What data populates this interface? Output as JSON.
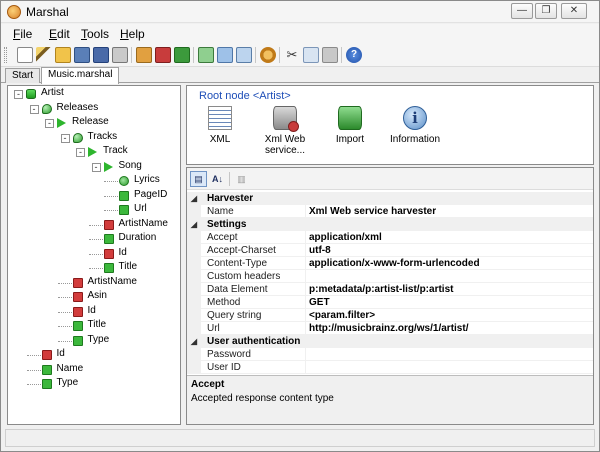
{
  "window": {
    "title": "Marshal",
    "minimize_glyph": "—",
    "restore_glyph": "❐",
    "close_glyph": "✕"
  },
  "menu": [
    {
      "label": "File",
      "key": "F",
      "rest": "ile"
    },
    {
      "label": "Edit",
      "key": "E",
      "rest": "dit"
    },
    {
      "label": "Tools",
      "key": "T",
      "rest": "ools"
    },
    {
      "label": "Help",
      "key": "H",
      "rest": "elp"
    }
  ],
  "toolbar": {
    "icons": [
      "new-icon",
      "wand-icon",
      "open-icon",
      "save-icon",
      "save-all-icon",
      "print-icon",
      "export-icon",
      "import-icon",
      "harvest-icon",
      "validate-icon",
      "template-icon",
      "schema-icon",
      "options-icon",
      "cut-icon",
      "copy-icon",
      "paste-icon",
      "help-icon"
    ]
  },
  "tabs": [
    {
      "label": "Start",
      "active": false
    },
    {
      "label": "Music.marshal",
      "active": true
    }
  ],
  "tree": [
    {
      "label": "Artist",
      "icon": "db",
      "depth": 0,
      "expander": "-"
    },
    {
      "label": "Releases",
      "icon": "key",
      "depth": 1,
      "expander": "-"
    },
    {
      "label": "Release",
      "icon": "play",
      "depth": 2,
      "expander": "-"
    },
    {
      "label": "Tracks",
      "icon": "key",
      "depth": 3,
      "expander": "-"
    },
    {
      "label": "Track",
      "icon": "play",
      "depth": 4,
      "expander": "-"
    },
    {
      "label": "Song",
      "icon": "play",
      "depth": 5,
      "expander": "-"
    },
    {
      "label": "Lyrics",
      "icon": "circle",
      "depth": 6
    },
    {
      "label": "PageID",
      "icon": "green",
      "depth": 6
    },
    {
      "label": "Url",
      "icon": "green",
      "depth": 6
    },
    {
      "label": "ArtistName",
      "icon": "red",
      "depth": 5
    },
    {
      "label": "Duration",
      "icon": "green",
      "depth": 5
    },
    {
      "label": "Id",
      "icon": "red",
      "depth": 5
    },
    {
      "label": "Title",
      "icon": "green",
      "depth": 5
    },
    {
      "label": "ArtistName",
      "icon": "red",
      "depth": 3
    },
    {
      "label": "Asin",
      "icon": "red",
      "depth": 3
    },
    {
      "label": "Id",
      "icon": "red",
      "depth": 3
    },
    {
      "label": "Title",
      "icon": "green",
      "depth": 3
    },
    {
      "label": "Type",
      "icon": "green",
      "depth": 3
    },
    {
      "label": "Id",
      "icon": "red",
      "depth": 1
    },
    {
      "label": "Name",
      "icon": "green",
      "depth": 1
    },
    {
      "label": "Type",
      "icon": "green",
      "depth": 1
    }
  ],
  "root_node": {
    "title": "Root node <Artist>",
    "actions": [
      {
        "label": "XML",
        "icon": "xml-icon"
      },
      {
        "label": "Xml Web service...",
        "icon": "web-service-icon"
      },
      {
        "label": "Import",
        "icon": "import-icon"
      },
      {
        "label": "Information",
        "icon": "information-icon"
      }
    ]
  },
  "property_grid": {
    "sort_buttons": [
      "categorized-icon",
      "alphabetical-icon",
      "property-pages-icon"
    ],
    "rows": [
      {
        "type": "category",
        "name": "Harvester"
      },
      {
        "type": "prop",
        "name": "Name",
        "value": "Xml Web service harvester"
      },
      {
        "type": "category",
        "name": "Settings"
      },
      {
        "type": "prop",
        "name": "Accept",
        "value": "application/xml"
      },
      {
        "type": "prop",
        "name": "Accept-Charset",
        "value": "utf-8"
      },
      {
        "type": "prop",
        "name": "Content-Type",
        "value": "application/x-www-form-urlencoded"
      },
      {
        "type": "prop",
        "name": "Custom headers",
        "value": ""
      },
      {
        "type": "prop",
        "name": "Data Element",
        "value": "p:metadata/p:artist-list/p:artist"
      },
      {
        "type": "prop",
        "name": "Method",
        "value": "GET"
      },
      {
        "type": "prop",
        "name": "Query string",
        "value": "<param.filter>"
      },
      {
        "type": "prop",
        "name": "Url",
        "value": "http://musicbrainz.org/ws/1/artist/"
      },
      {
        "type": "category",
        "name": "User authentication"
      },
      {
        "type": "prop",
        "name": "Password",
        "value": ""
      },
      {
        "type": "prop",
        "name": "User ID",
        "value": ""
      }
    ],
    "help": {
      "title": "Accept",
      "description": "Accepted response content type"
    }
  }
}
